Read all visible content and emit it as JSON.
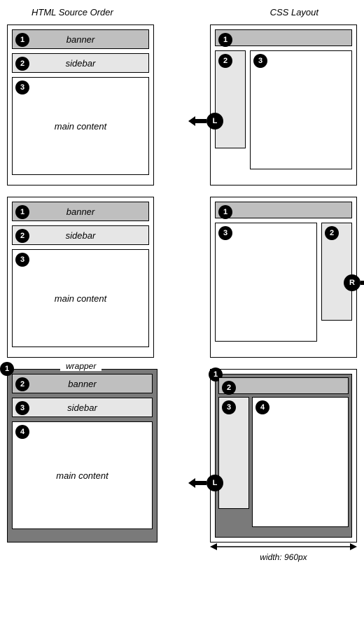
{
  "titles": {
    "left": "HTML Source Order",
    "right": "CSS Layout"
  },
  "badges": {
    "n1": "1",
    "n2": "2",
    "n3": "3",
    "n4": "4",
    "L": "L",
    "R": "R"
  },
  "labels": {
    "banner": "banner",
    "sidebar": "sidebar",
    "main": "main content",
    "wrapper": "wrapper"
  },
  "width_label": "width: 960px"
}
